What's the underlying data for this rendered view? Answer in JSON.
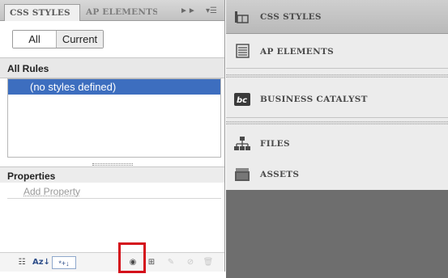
{
  "css_panel": {
    "tabs": [
      {
        "label": "CSS STYLES"
      },
      {
        "label": "AP ELEMENTS"
      }
    ],
    "tab_controls": {
      "expand": "►►",
      "menu": "▾☰"
    },
    "mode": {
      "all": "All",
      "current": "Current"
    },
    "all_rules": {
      "heading": "All Rules",
      "items": [
        "(no styles defined)"
      ]
    },
    "properties": {
      "heading": "Properties",
      "add_property": "Add Property"
    },
    "toolbar": {
      "category_view": "☷",
      "alpha_view": "Az↓",
      "set_props": "*+↓",
      "attach": "◉",
      "new": "⊞",
      "edit": "✎",
      "disable": "⊘",
      "delete": "🗑"
    }
  },
  "side_panels": {
    "items": [
      {
        "label": "CSS STYLES"
      },
      {
        "label": "AP ELEMENTS"
      },
      {
        "label": "BUSINESS CATALYST",
        "icon_text": "bc"
      },
      {
        "label": "FILES"
      },
      {
        "label": "ASSETS"
      }
    ]
  },
  "colors": {
    "selection": "#3d6ebf",
    "highlight": "#d4101b",
    "panel_dark": "#6e6e6e"
  }
}
